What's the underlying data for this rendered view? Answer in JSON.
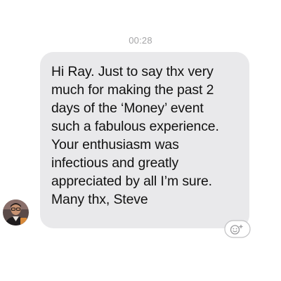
{
  "conversation": {
    "timestamp": "00:28",
    "message": {
      "text": "Hi Ray. Just to say thx very\nmuch for making the past 2\ndays of the ‘Money’ event\nsuch a fabulous experience.\nYour enthusiasm was\ninfectious and greatly\nappreciated by all I’m sure.\nMany thx, Steve",
      "sender_avatar_icon": "avatar-steve",
      "reaction_icon": "add-reaction-icon"
    }
  },
  "colors": {
    "background": "#ffffff",
    "bubble": "#e9e9eb",
    "text": "#111111",
    "timestamp": "#a4a4a6",
    "reaction_outline": "#c2c2c4"
  }
}
